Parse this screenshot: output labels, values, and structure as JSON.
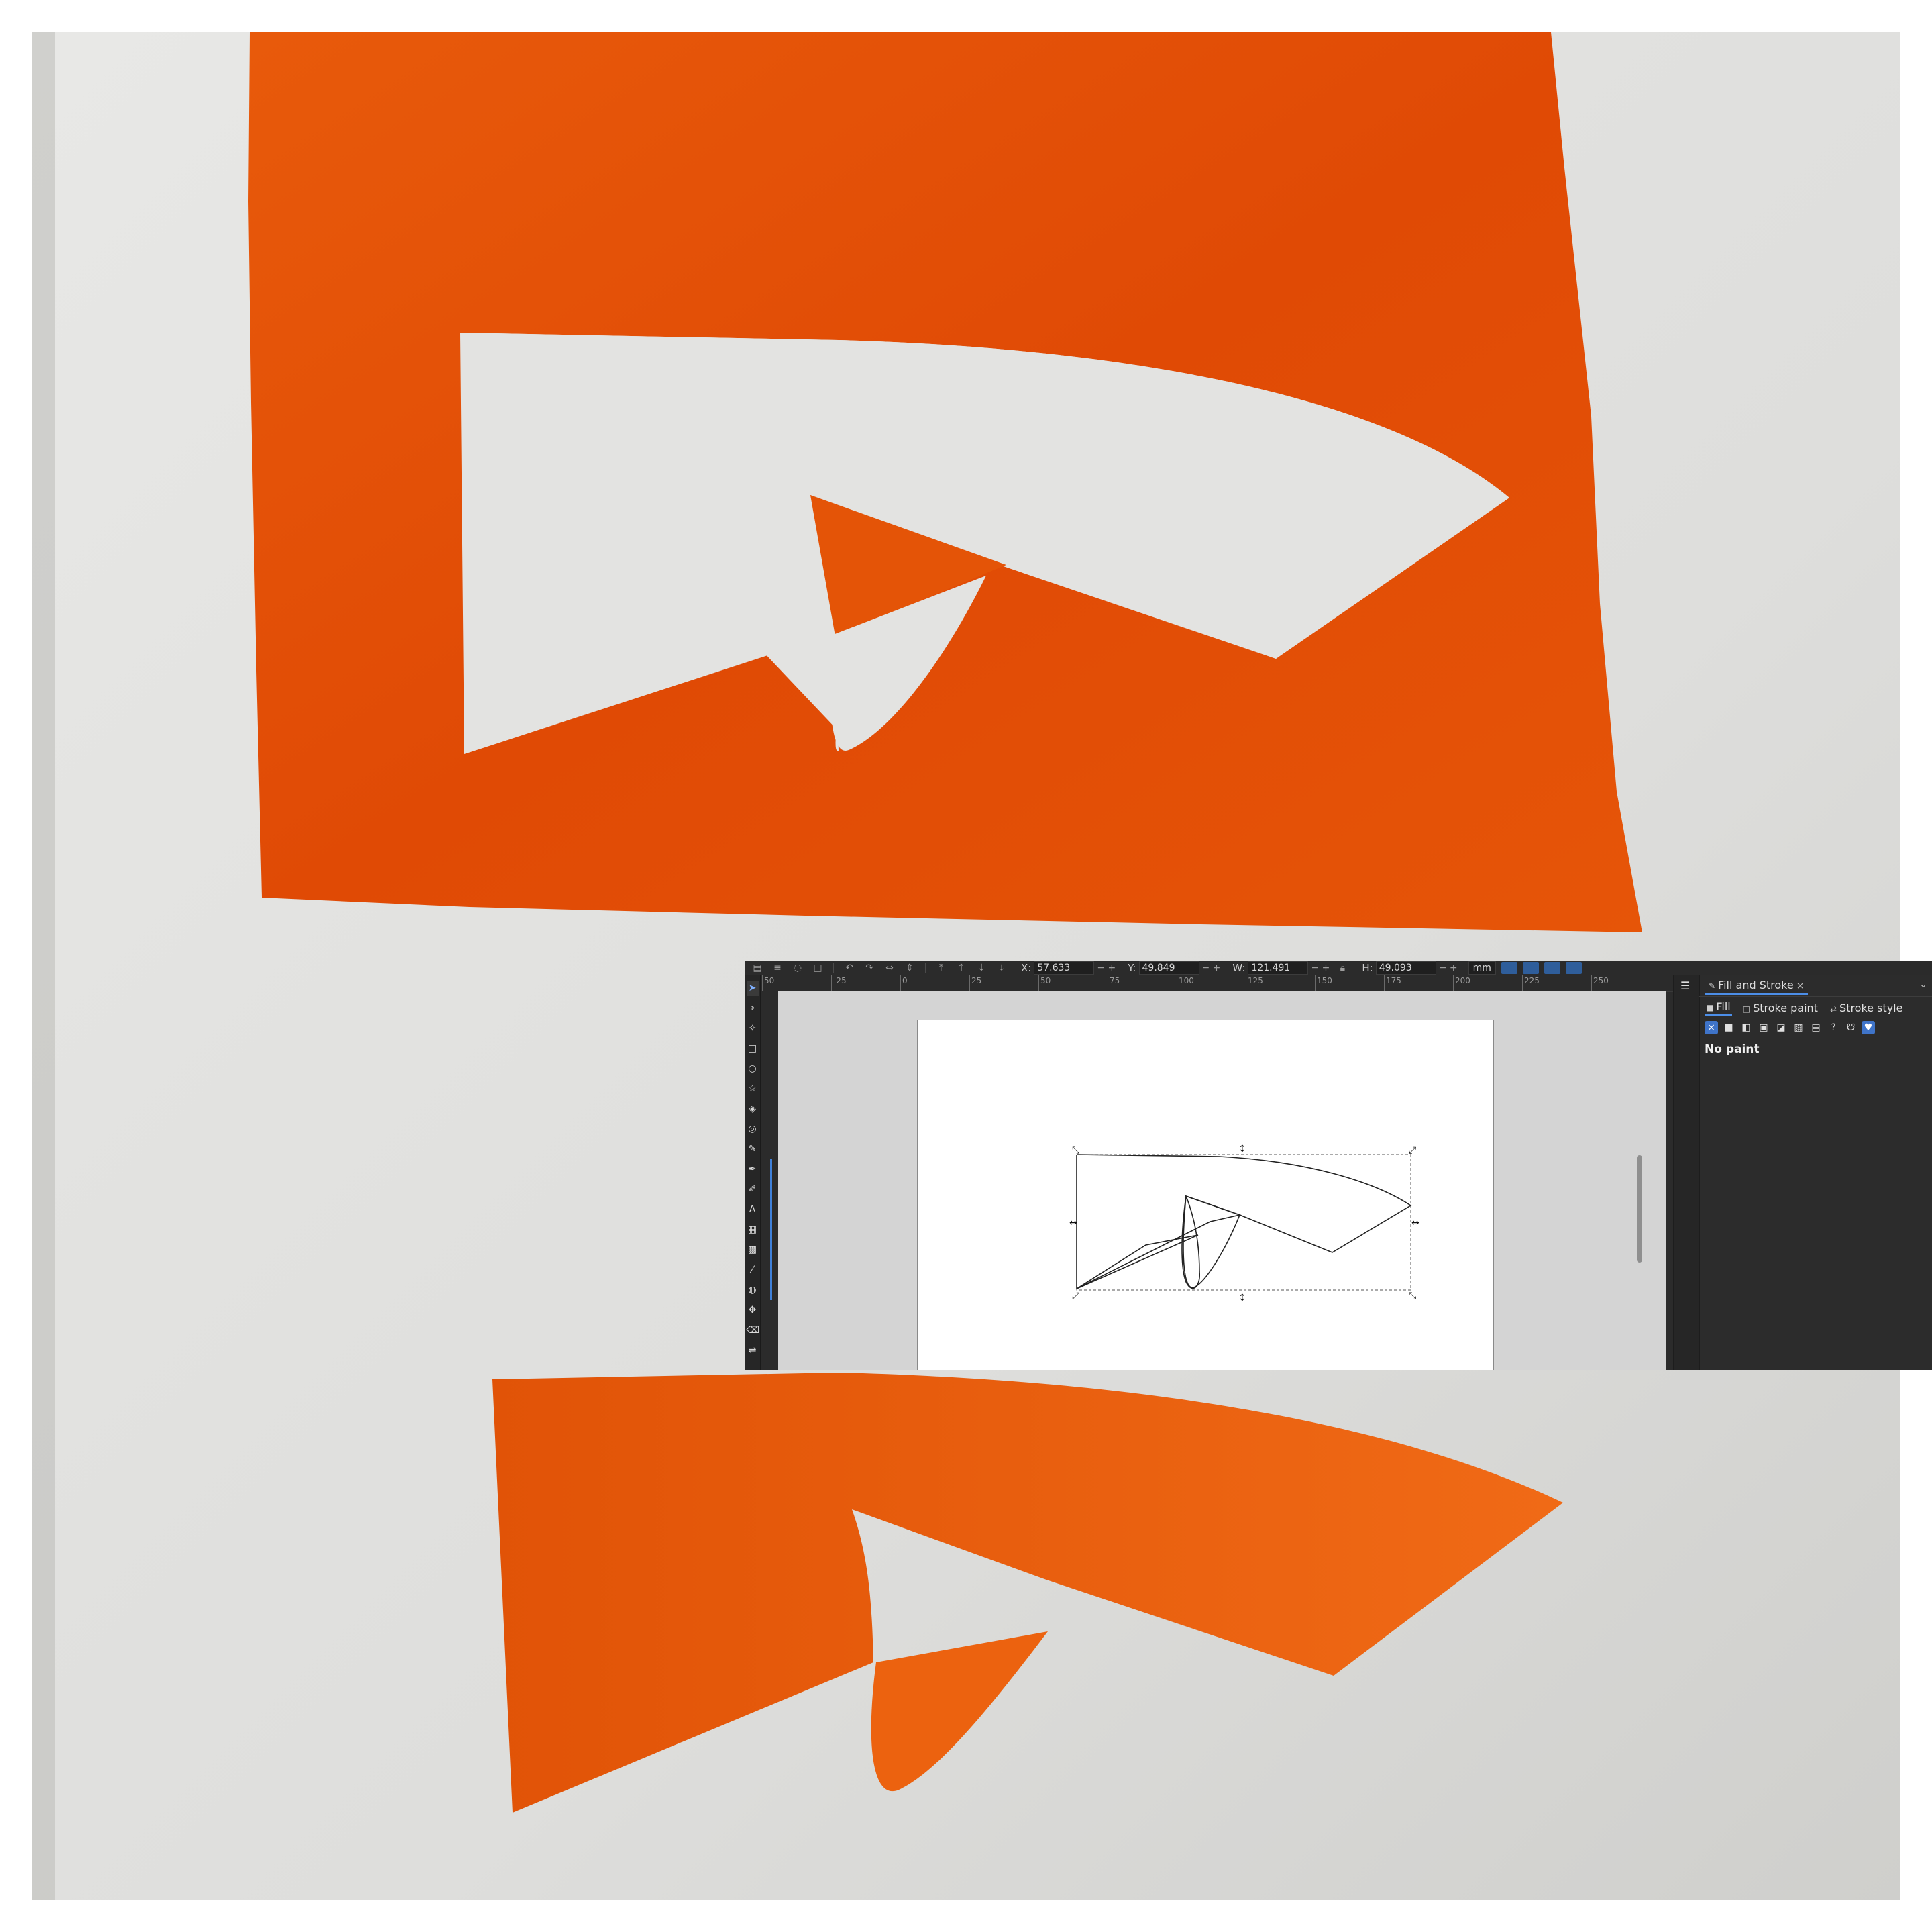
{
  "colors": {
    "orange": "#e55509",
    "orange_light": "#f06812",
    "paper": "#e4e4e2",
    "paper_shadow": "#c9c9c6",
    "ui_dark": "#2b2b2b",
    "ui_accent": "#4c8ee8"
  },
  "photos": {
    "top": {
      "description_icon": "paper-cutout-stencil"
    },
    "bottom": {
      "description_icon": "paper-cutout-shape"
    }
  },
  "inkscape": {
    "toolbar": {
      "x_label": "X:",
      "x_value": "57.633",
      "y_label": "Y:",
      "y_value": "49.849",
      "w_label": "W:",
      "w_value": "121.491",
      "h_label": "H:",
      "h_value": "49.093",
      "unit": "mm"
    },
    "ruler": {
      "labels": [
        "50",
        "-25",
        "0",
        "25",
        "50",
        "75",
        "100",
        "125",
        "150",
        "175",
        "200",
        "225",
        "250"
      ]
    },
    "tools": [
      "selector-tool-icon",
      "node-tool-icon",
      "tweak-tool-icon",
      "rect-tool-icon",
      "ellipse-tool-icon",
      "star-tool-icon",
      "3dbox-tool-icon",
      "spiral-tool-icon",
      "pencil-tool-icon",
      "pen-tool-icon",
      "calligraphy-tool-icon",
      "text-tool-icon",
      "gradient-tool-icon",
      "mesh-tool-icon",
      "dropper-tool-icon",
      "paint-bucket-icon",
      "spray-tool-icon",
      "eraser-tool-icon",
      "connector-tool-icon"
    ],
    "tool_glyphs": [
      "➤",
      "⌖",
      "✧",
      "□",
      "○",
      "☆",
      "◈",
      "◎",
      "✎",
      "✒",
      "✐",
      "A",
      "▦",
      "▩",
      "⁄",
      "◍",
      "✥",
      "⌫",
      "⇌"
    ],
    "panel": {
      "tab_label": "Fill and Stroke",
      "subtabs": [
        "Fill",
        "Stroke paint",
        "Stroke style"
      ],
      "paint_types": [
        "×",
        "■",
        "◧",
        "▣",
        "◪",
        "▨",
        "▤",
        "?",
        "☋",
        "♥"
      ],
      "status": "No paint"
    }
  }
}
